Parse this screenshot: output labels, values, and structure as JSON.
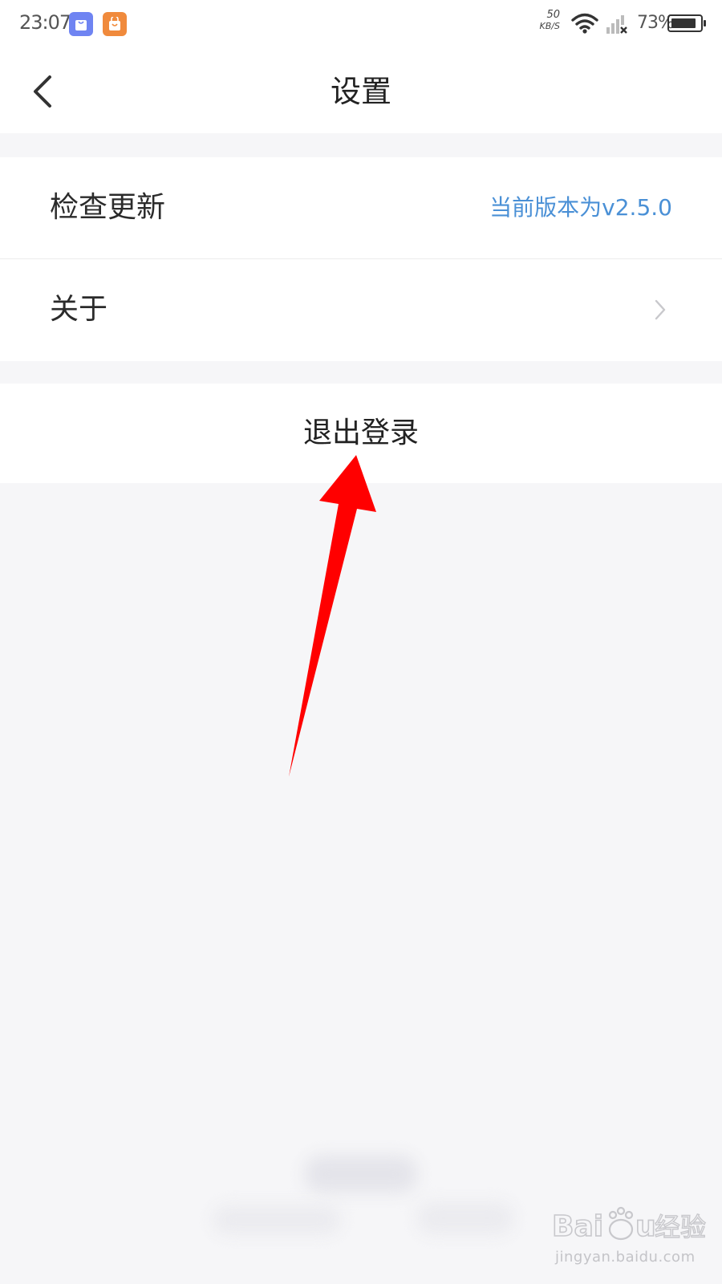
{
  "status_bar": {
    "time": "23:07",
    "net_speed_value": "50",
    "net_speed_unit": "KB/S",
    "battery": "73%",
    "icons": [
      "app-blue-icon",
      "app-orange-icon",
      "wifi-icon",
      "signal-icon",
      "battery-icon"
    ],
    "battery_level": 0.73
  },
  "nav": {
    "title": "设置",
    "back_icon": "chevron-left-icon"
  },
  "settings": {
    "items": [
      {
        "label": "检查更新",
        "value": "当前版本为v2.5.0"
      },
      {
        "label": "关于",
        "icon": "chevron-right-icon"
      }
    ],
    "logout_label": "退出登录"
  },
  "watermark": {
    "logo": "Baidu经验",
    "site": "jingyan.baidu.com"
  },
  "colors": {
    "accent": "#4a90d6",
    "background": "#f6f6f8",
    "annotation_arrow": "#ff0000"
  }
}
